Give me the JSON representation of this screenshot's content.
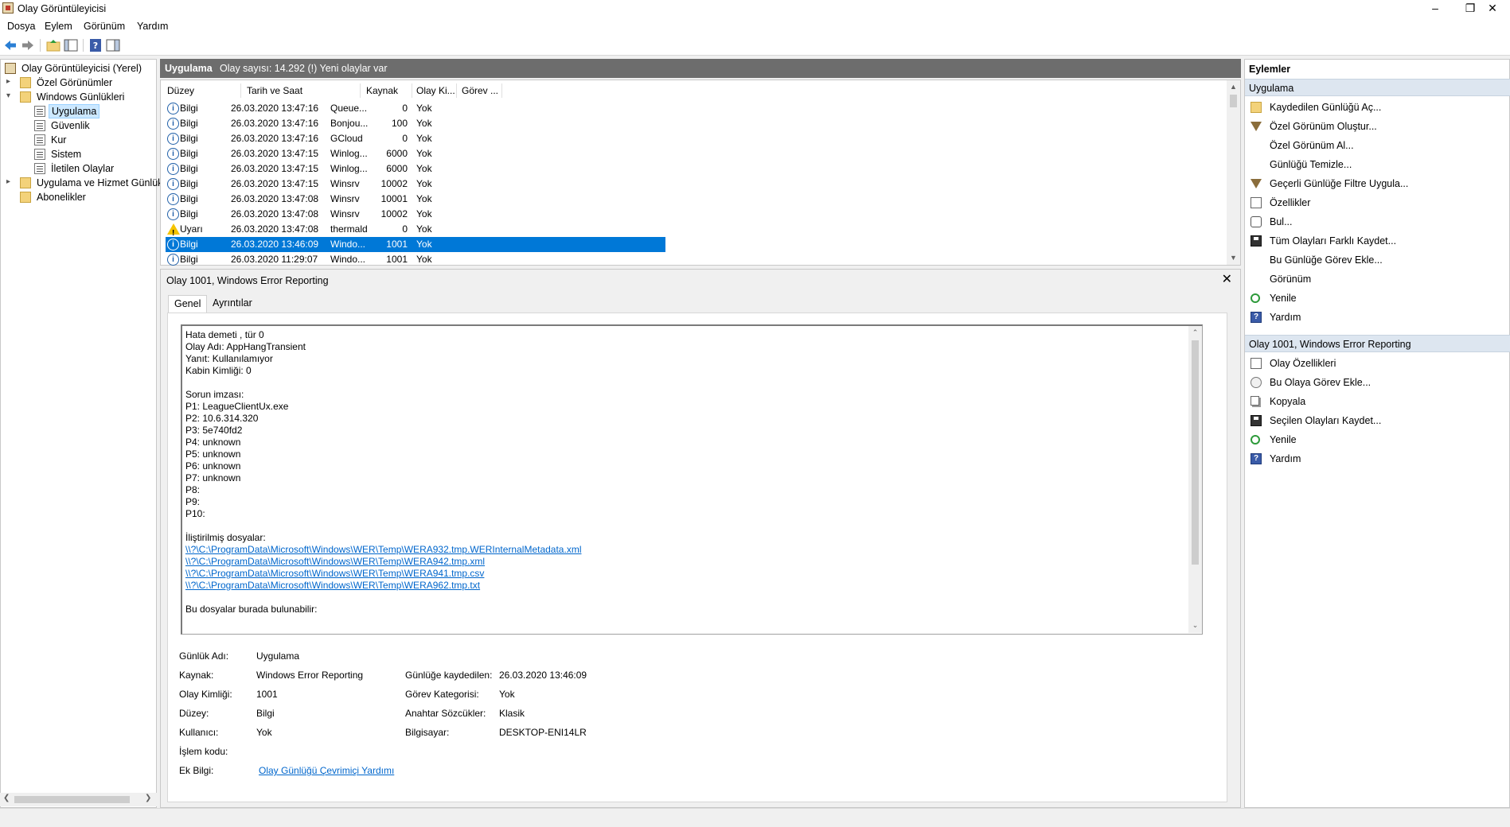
{
  "window": {
    "title": "Olay Görüntüleyicisi"
  },
  "menu": [
    "Dosya",
    "Eylem",
    "Görünüm",
    "Yardım"
  ],
  "tree": {
    "root": "Olay Görüntüleyicisi (Yerel)",
    "custom_views": "Özel Görünümler",
    "windows_logs": "Windows Günlükleri",
    "logs": [
      "Uygulama",
      "Güvenlik",
      "Kur",
      "Sistem",
      "İletilen Olaylar"
    ],
    "app_services": "Uygulama ve Hizmet Günlük",
    "subscriptions": "Abonelikler"
  },
  "center_header": {
    "title": "Uygulama",
    "info": "Olay sayısı: 14.292 (!) Yeni olaylar var"
  },
  "table": {
    "columns": [
      "Düzey",
      "Tarih ve Saat",
      "Kaynak",
      "Olay Ki...",
      "Görev ..."
    ],
    "rows": [
      {
        "level": "Bilgi",
        "type": "info",
        "date": "26.03.2020 13:47:16",
        "source": "Queue...",
        "id": "0",
        "task": "Yok"
      },
      {
        "level": "Bilgi",
        "type": "info",
        "date": "26.03.2020 13:47:16",
        "source": "Bonjou...",
        "id": "100",
        "task": "Yok"
      },
      {
        "level": "Bilgi",
        "type": "info",
        "date": "26.03.2020 13:47:16",
        "source": "GCloud",
        "id": "0",
        "task": "Yok"
      },
      {
        "level": "Bilgi",
        "type": "info",
        "date": "26.03.2020 13:47:15",
        "source": "Winlog...",
        "id": "6000",
        "task": "Yok"
      },
      {
        "level": "Bilgi",
        "type": "info",
        "date": "26.03.2020 13:47:15",
        "source": "Winlog...",
        "id": "6000",
        "task": "Yok"
      },
      {
        "level": "Bilgi",
        "type": "info",
        "date": "26.03.2020 13:47:15",
        "source": "Winsrv",
        "id": "10002",
        "task": "Yok"
      },
      {
        "level": "Bilgi",
        "type": "info",
        "date": "26.03.2020 13:47:08",
        "source": "Winsrv",
        "id": "10001",
        "task": "Yok"
      },
      {
        "level": "Bilgi",
        "type": "info",
        "date": "26.03.2020 13:47:08",
        "source": "Winsrv",
        "id": "10002",
        "task": "Yok"
      },
      {
        "level": "Uyarı",
        "type": "warn",
        "date": "26.03.2020 13:47:08",
        "source": "thermald",
        "id": "0",
        "task": "Yok"
      },
      {
        "level": "Bilgi",
        "type": "info",
        "date": "26.03.2020 13:46:09",
        "source": "Windo...",
        "id": "1001",
        "task": "Yok",
        "selected": true
      },
      {
        "level": "Bilgi",
        "type": "info",
        "date": "26.03.2020 11:29:07",
        "source": "Windo...",
        "id": "1001",
        "task": "Yok"
      }
    ]
  },
  "detail": {
    "title": "Olay 1001, Windows Error Reporting",
    "tabs": [
      "Genel",
      "Ayrıntılar"
    ],
    "description": [
      "Hata demeti , tür 0",
      "Olay Adı: AppHangTransient",
      "Yanıt: Kullanılamıyor",
      "Kabin Kimliği: 0",
      "",
      "Sorun imzası:",
      "P1: LeagueClientUx.exe",
      "P2: 10.6.314.320",
      "P3: 5e740fd2",
      "P4: unknown",
      "P5: unknown",
      "P6: unknown",
      "P7: unknown",
      "P8: ",
      "P9: ",
      "P10: ",
      "",
      "İliştirilmiş dosyalar:"
    ],
    "links": [
      "\\\\?\\C:\\ProgramData\\Microsoft\\Windows\\WER\\Temp\\WERA932.tmp.WERInternalMetadata.xml",
      "\\\\?\\C:\\ProgramData\\Microsoft\\Windows\\WER\\Temp\\WERA942.tmp.xml",
      "\\\\?\\C:\\ProgramData\\Microsoft\\Windows\\WER\\Temp\\WERA941.tmp.csv",
      "\\\\?\\C:\\ProgramData\\Microsoft\\Windows\\WER\\Temp\\WERA962.tmp.txt"
    ],
    "desc_tail": "Bu dosyalar burada bulunabilir:",
    "meta": {
      "log_name_label": "Günlük Adı:",
      "log_name": "Uygulama",
      "source_label": "Kaynak:",
      "source": "Windows Error Reporting",
      "logged_label": "Günlüğe kaydedilen:",
      "logged": "26.03.2020 13:46:09",
      "event_id_label": "Olay Kimliği:",
      "event_id": "1001",
      "task_cat_label": "Görev Kategorisi:",
      "task_cat": "Yok",
      "level_label": "Düzey:",
      "level": "Bilgi",
      "keywords_label": "Anahtar Sözcükler:",
      "keywords": "Klasik",
      "user_label": "Kullanıcı:",
      "user": "Yok",
      "computer_label": "Bilgisayar:",
      "computer": "DESKTOP-ENI14LR",
      "opcode_label": "İşlem kodu:",
      "more_info_label": "Ek Bilgi:",
      "more_info_link": "Olay Günlüğü Çevrimiçi Yardımı"
    }
  },
  "actions": {
    "header": "Eylemler",
    "section1": "Uygulama",
    "items1": [
      {
        "label": "Kaydedilen Günlüğü Aç...",
        "icon": "open"
      },
      {
        "label": "Özel Görünüm Oluştur...",
        "icon": "filter"
      },
      {
        "label": "Özel Görünüm Al...",
        "icon": ""
      },
      {
        "label": "Günlüğü Temizle...",
        "icon": ""
      },
      {
        "label": "Geçerli Günlüğe Filtre Uygula...",
        "icon": "filter"
      },
      {
        "label": "Özellikler",
        "icon": "props"
      },
      {
        "label": "Bul...",
        "icon": "find"
      },
      {
        "label": "Tüm Olayları Farklı Kaydet...",
        "icon": "save"
      },
      {
        "label": "Bu Günlüğe Görev Ekle...",
        "icon": ""
      },
      {
        "label": "Görünüm",
        "icon": ""
      },
      {
        "label": "Yenile",
        "icon": "refresh"
      },
      {
        "label": "Yardım",
        "icon": "help"
      }
    ],
    "section2": "Olay 1001, Windows Error Reporting",
    "items2": [
      {
        "label": "Olay Özellikleri",
        "icon": "props"
      },
      {
        "label": "Bu Olaya Görev Ekle...",
        "icon": "task"
      },
      {
        "label": "Kopyala",
        "icon": "copy"
      },
      {
        "label": "Seçilen Olayları Kaydet...",
        "icon": "save"
      },
      {
        "label": "Yenile",
        "icon": "refresh"
      },
      {
        "label": "Yardım",
        "icon": "help"
      }
    ]
  }
}
